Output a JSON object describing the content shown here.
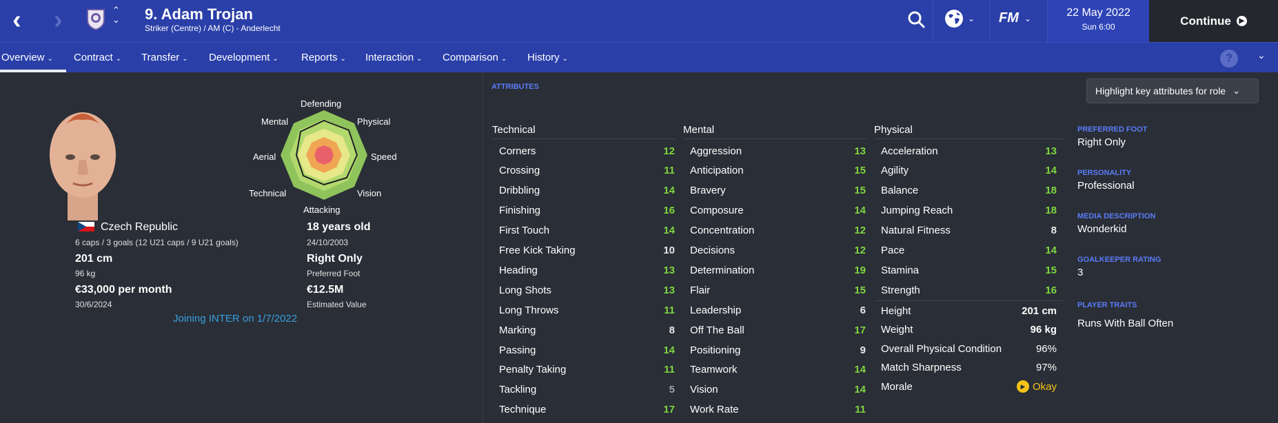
{
  "header": {
    "title": "9. Adam Trojan",
    "subtitle": "Striker (Centre) / AM (C) - Anderlecht",
    "date": "22 May 2022",
    "time": "Sun 6:00",
    "continue_label": "Continue",
    "fm_logo": "FM"
  },
  "tabs": [
    {
      "label": "Overview"
    },
    {
      "label": "Contract"
    },
    {
      "label": "Transfer"
    },
    {
      "label": "Development"
    },
    {
      "label": "Reports"
    },
    {
      "label": "Interaction"
    },
    {
      "label": "Comparison"
    },
    {
      "label": "History"
    }
  ],
  "help_label": "?",
  "radar": {
    "labels": [
      "Defending",
      "Physical",
      "Speed",
      "Vision",
      "Attacking",
      "Technical",
      "Aerial",
      "Mental"
    ]
  },
  "bio": {
    "nationality": "Czech Republic",
    "caps": "6 caps / 3 goals (12 U21 caps / 9 U21 goals)",
    "height": "201 cm",
    "weight": "96 kg",
    "wage": "€33,000 per month",
    "contract_end": "30/6/2024",
    "age": "18 years old",
    "dob": "24/10/2003",
    "foot": "Right Only",
    "foot_label": "Preferred Foot",
    "value": "€12.5M",
    "value_label": "Estimated Value",
    "joining": "Joining INTER on 1/7/2022"
  },
  "attributes": {
    "section_label": "ATTRIBUTES",
    "highlight_label": "Highlight key attributes for role",
    "technical": {
      "title": "Technical",
      "items": [
        {
          "name": "Corners",
          "value": "12"
        },
        {
          "name": "Crossing",
          "value": "11"
        },
        {
          "name": "Dribbling",
          "value": "14"
        },
        {
          "name": "Finishing",
          "value": "16"
        },
        {
          "name": "First Touch",
          "value": "14"
        },
        {
          "name": "Free Kick Taking",
          "value": "10"
        },
        {
          "name": "Heading",
          "value": "13"
        },
        {
          "name": "Long Shots",
          "value": "13"
        },
        {
          "name": "Long Throws",
          "value": "11"
        },
        {
          "name": "Marking",
          "value": "8"
        },
        {
          "name": "Passing",
          "value": "14"
        },
        {
          "name": "Penalty Taking",
          "value": "11"
        },
        {
          "name": "Tackling",
          "value": "5"
        },
        {
          "name": "Technique",
          "value": "17"
        }
      ]
    },
    "mental": {
      "title": "Mental",
      "items": [
        {
          "name": "Aggression",
          "value": "13"
        },
        {
          "name": "Anticipation",
          "value": "15"
        },
        {
          "name": "Bravery",
          "value": "15"
        },
        {
          "name": "Composure",
          "value": "14"
        },
        {
          "name": "Concentration",
          "value": "12"
        },
        {
          "name": "Decisions",
          "value": "12"
        },
        {
          "name": "Determination",
          "value": "19"
        },
        {
          "name": "Flair",
          "value": "15"
        },
        {
          "name": "Leadership",
          "value": "6"
        },
        {
          "name": "Off The Ball",
          "value": "17"
        },
        {
          "name": "Positioning",
          "value": "9"
        },
        {
          "name": "Teamwork",
          "value": "14"
        },
        {
          "name": "Vision",
          "value": "14"
        },
        {
          "name": "Work Rate",
          "value": "11"
        }
      ]
    },
    "physical": {
      "title": "Physical",
      "items": [
        {
          "name": "Acceleration",
          "value": "13"
        },
        {
          "name": "Agility",
          "value": "14"
        },
        {
          "name": "Balance",
          "value": "18"
        },
        {
          "name": "Jumping Reach",
          "value": "18"
        },
        {
          "name": "Natural Fitness",
          "value": "8"
        },
        {
          "name": "Pace",
          "value": "14"
        },
        {
          "name": "Stamina",
          "value": "15"
        },
        {
          "name": "Strength",
          "value": "16"
        }
      ],
      "extra": [
        {
          "name": "Height",
          "value": "201 cm"
        },
        {
          "name": "Weight",
          "value": "96 kg"
        },
        {
          "name": "Overall Physical Condition",
          "value": "96%"
        },
        {
          "name": "Match Sharpness",
          "value": "97%"
        },
        {
          "name": "Morale",
          "value": "Okay"
        }
      ]
    }
  },
  "info": {
    "preferred_foot_label": "PREFERRED FOOT",
    "preferred_foot": "Right Only",
    "personality_label": "PERSONALITY",
    "personality": "Professional",
    "media_label": "MEDIA DESCRIPTION",
    "media": "Wonderkid",
    "gk_label": "GOALKEEPER RATING",
    "gk": "3",
    "traits_label": "PLAYER TRAITS",
    "traits": "Runs With Ball Often"
  },
  "colors": {
    "header_bg": "#2a3fa8",
    "body_bg": "#2a2e36",
    "attr_good": "#7fd640",
    "attr_mid": "#e8e8e8",
    "attr_low": "#9aa0a8",
    "section_label": "#5b7cfa",
    "morale": "#f5c518"
  }
}
